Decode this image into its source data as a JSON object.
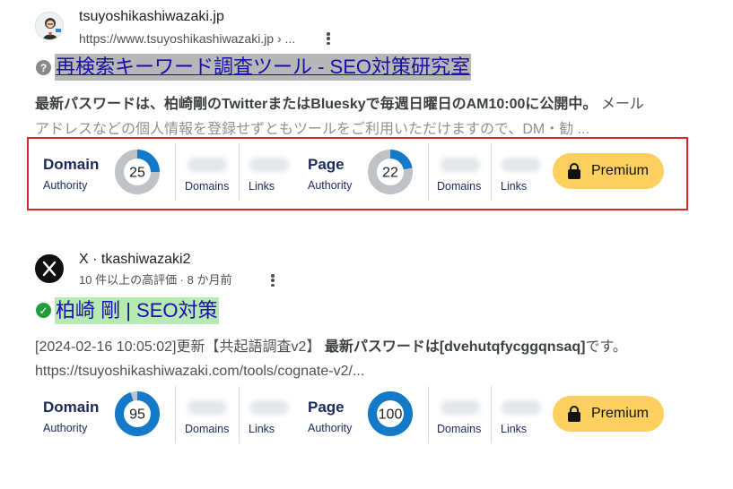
{
  "colors": {
    "red_frame": "#d9262c",
    "title_link": "#1a0dab",
    "donut_fill": "#1479c9",
    "donut_track": "#bfc2c6",
    "premium": "#fcd05e"
  },
  "results": [
    {
      "site_name": "tsuyoshikashiwazaki.jp",
      "site_url": "https://www.tsuyoshikashiwazaki.jp › ...",
      "status_icon": "question-circle-icon",
      "title": "再検索キーワード調査ツール - SEO対策研究室",
      "snippet_line1_bold": "最新パスワードは、柏崎剛のTwitterまたはBlueskyで毎週日曜日のAM10:00に公開中。",
      "snippet_line1_rest": " メール",
      "snippet_line2": "アドレスなどの個人情報を登録せずともツールをご利用いただけますので、DM・勧 ...",
      "seo": {
        "domain_label": "Domain",
        "domain_sub": "Authority",
        "domain_score": 25,
        "domain_pct": 25,
        "col1": "Domains",
        "col2": "Links",
        "page_label": "Page",
        "page_sub": "Authority",
        "page_score": 22,
        "page_pct": 22,
        "col3": "Domains",
        "col4": "Links",
        "premium": "Premium"
      }
    },
    {
      "site_name": "X · tkashiwazaki2",
      "site_url": "10 件以上の高評価 · 8 か月前",
      "status_icon": "check-circle-icon",
      "title": "柏崎 剛 | SEO対策",
      "snippet_line1_plain": "[2024-02-16 10:05:02]更新【共起語調査v2】 ",
      "snippet_line1_bold": "最新パスワードは[dvehutqfycggqnsaq]",
      "snippet_line1_tail": "です。",
      "snippet_line2": "https://tsuyoshikashiwazaki.com/tools/cognate-v2/...",
      "seo": {
        "domain_label": "Domain",
        "domain_sub": "Authority",
        "domain_score": 95,
        "domain_pct": 95,
        "col1": "Domains",
        "col2": "Links",
        "page_label": "Page",
        "page_sub": "Authority",
        "page_score": 100,
        "page_pct": 100,
        "col3": "Domains",
        "col4": "Links",
        "premium": "Premium"
      }
    }
  ]
}
